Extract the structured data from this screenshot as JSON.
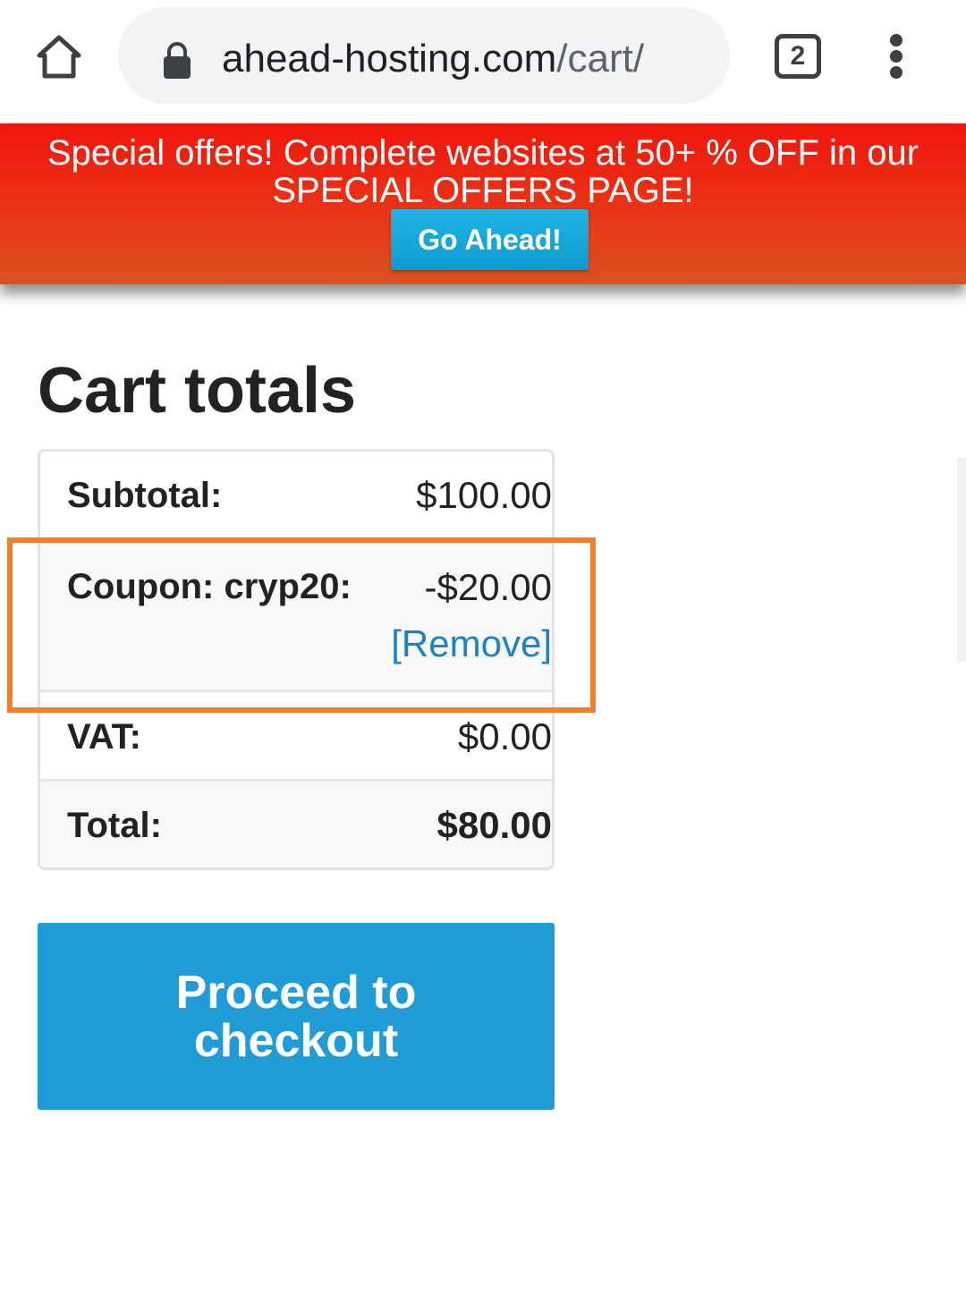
{
  "browser": {
    "url_domain": "ahead-hosting.com",
    "url_path": "/cart/",
    "tab_count": "2",
    "icons": [
      "home-icon",
      "lock-icon",
      "tabs-icon",
      "more-vert-icon"
    ]
  },
  "promo": {
    "text": "Special offers! Complete websites at 50+ % OFF in our SPECIAL OFFERS PAGE!",
    "button_label": "Go Ahead!"
  },
  "cart": {
    "title": "Cart totals",
    "subtotal_label": "Subtotal:",
    "subtotal_value": "$100.00",
    "coupon_label": "Coupon: cryp20:",
    "coupon_value": "-$20.00",
    "coupon_remove": "[Remove]",
    "vat_label": "VAT:",
    "vat_value": "$0.00",
    "total_label": "Total:",
    "total_value": "$80.00",
    "checkout_label": "Proceed to checkout"
  },
  "colors": {
    "banner_red": "#f0160d",
    "button_blue": "#1f9bd6",
    "link_blue": "#1b82c5",
    "highlight_orange": "#f57e2d"
  }
}
